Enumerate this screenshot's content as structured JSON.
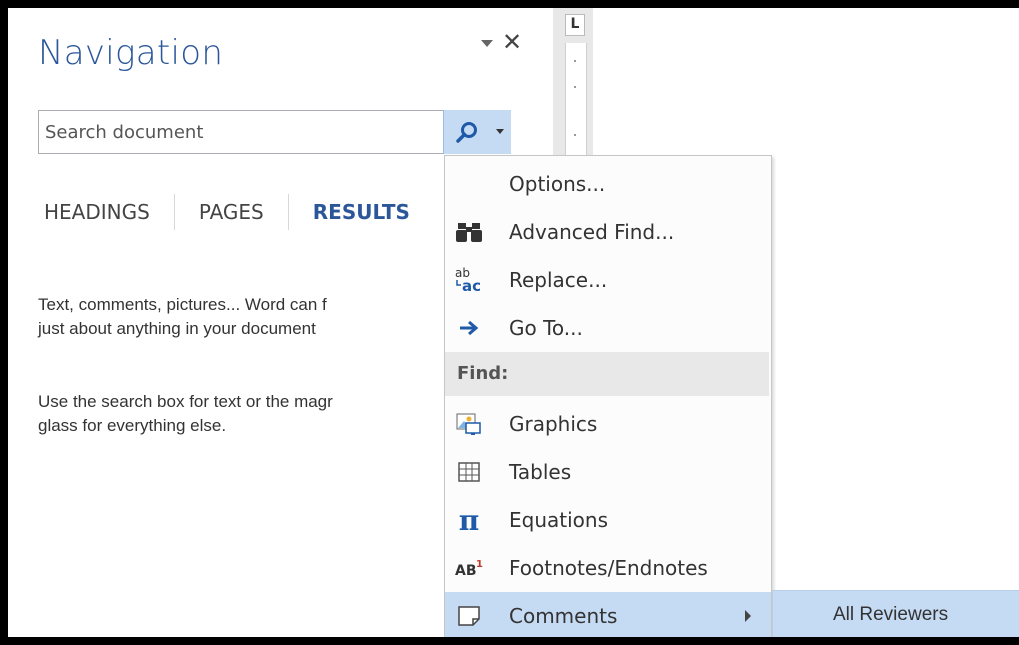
{
  "nav": {
    "title": "Navigation",
    "search_placeholder": "Search document",
    "tabs": [
      {
        "label": "HEADINGS"
      },
      {
        "label": "PAGES"
      },
      {
        "label": "RESULTS"
      }
    ],
    "desc1": "Text, comments, pictures... Word can f\njust about anything in your document",
    "desc2": "Use the search box for text or the magr\nglass for everything else."
  },
  "ruler": {
    "corner": "L"
  },
  "menu": {
    "items": [
      {
        "label": "Options...",
        "mnemonic": "O",
        "icon": "none"
      },
      {
        "label": "Advanced Find...",
        "mnemonic": "A",
        "icon": "binoculars-icon"
      },
      {
        "label": "Replace...",
        "mnemonic": "R",
        "icon": "replace-icon"
      },
      {
        "label": "Go To...",
        "mnemonic": "G",
        "icon": "arrow-right-icon"
      }
    ],
    "find_header": "Find:",
    "find_items": [
      {
        "label": "Graphics",
        "icon": "graphics-icon"
      },
      {
        "label": "Tables",
        "icon": "table-icon"
      },
      {
        "label": "Equations",
        "icon": "pi-icon"
      },
      {
        "label": "Footnotes/Endnotes",
        "icon": "footnote-icon"
      },
      {
        "label": "Comments",
        "icon": "comment-icon"
      }
    ]
  },
  "submenu": {
    "label": "All Reviewers"
  },
  "colors": {
    "accent": "#2b579a",
    "highlight": "#c5daf3"
  }
}
